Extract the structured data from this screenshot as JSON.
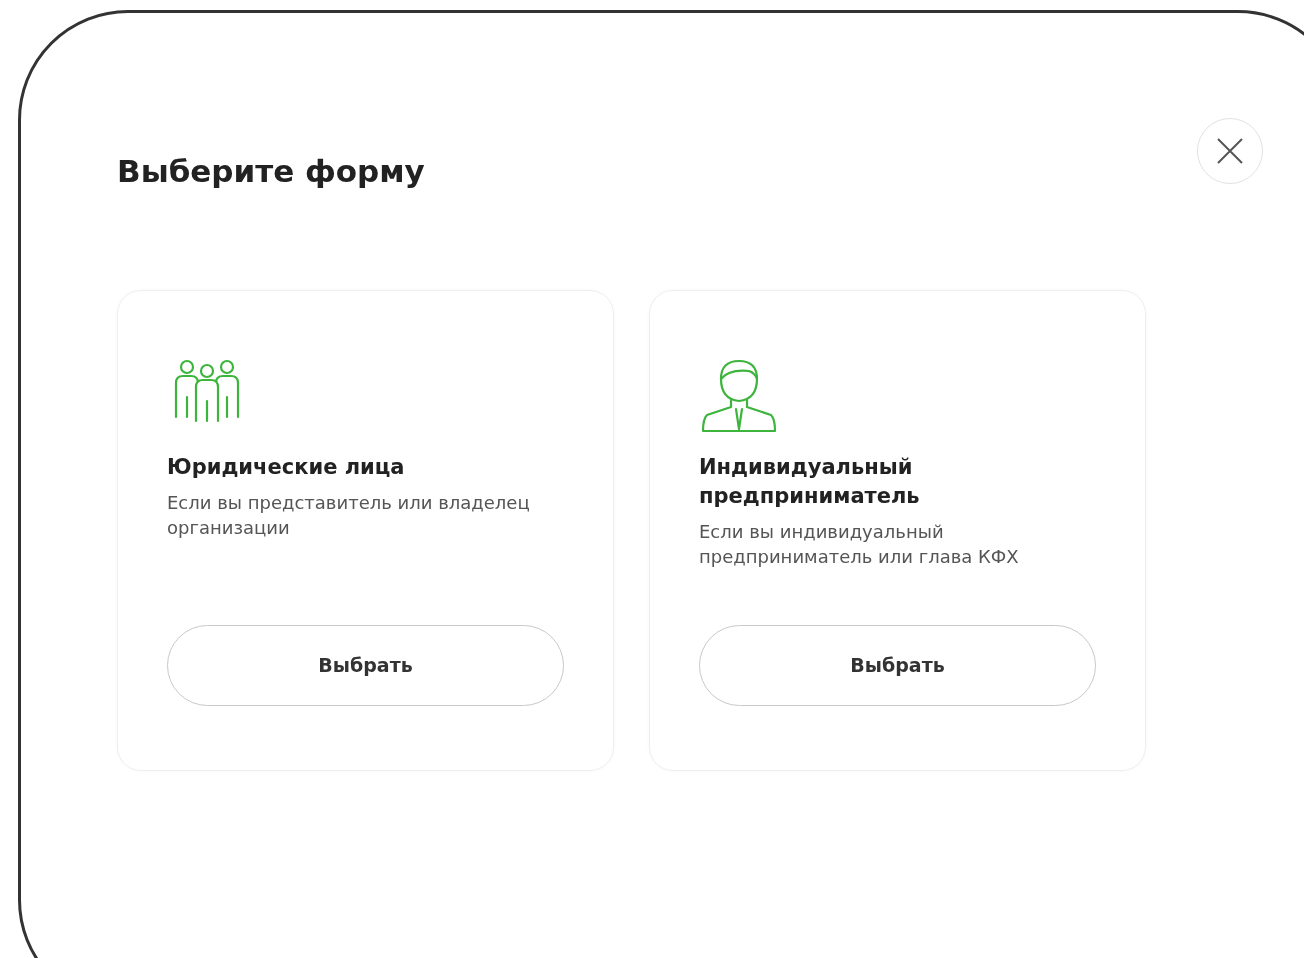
{
  "dialog": {
    "title": "Выберите форму"
  },
  "options": [
    {
      "kind": "company",
      "title": "Юридические лица",
      "description": "Если вы представитель или владелец организации",
      "button": "Выбрать"
    },
    {
      "kind": "individual",
      "title": "Индивидуальный предприниматель",
      "description": "Если вы индивидуальный предприниматель или глава КФХ",
      "button": "Выбрать"
    }
  ]
}
